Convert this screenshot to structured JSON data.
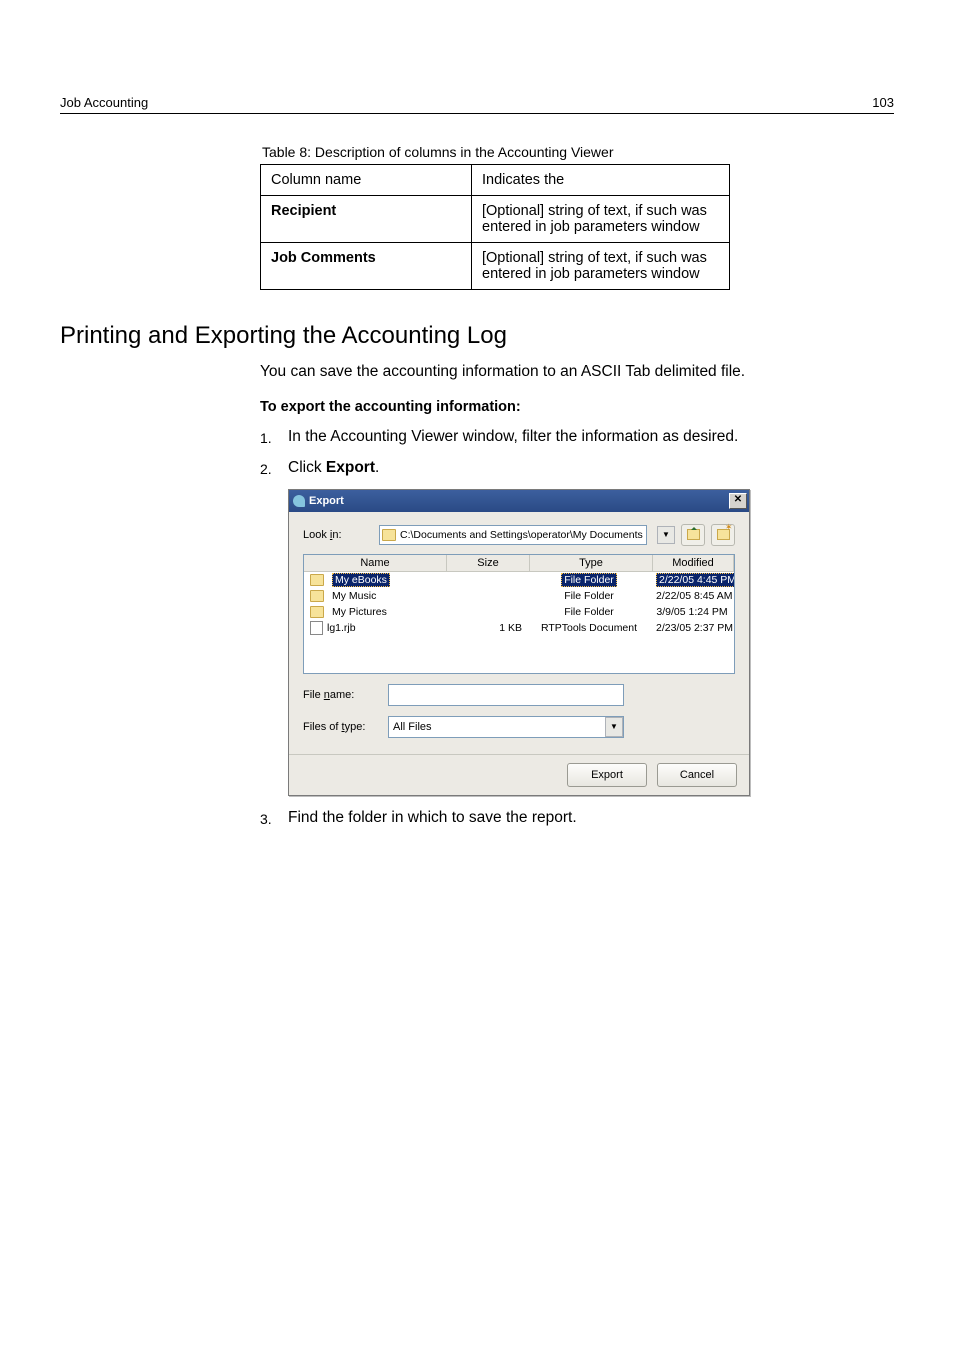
{
  "header": {
    "section": "Job Accounting",
    "page_number": "103"
  },
  "table": {
    "caption": "Table 8: Description of columns in the Accounting Viewer",
    "head": {
      "col1": "Column name",
      "col2": "Indicates the"
    },
    "rows": [
      {
        "name": "Recipient",
        "desc": "[Optional] string of text, if such was entered in job parameters window"
      },
      {
        "name": "Job Comments",
        "desc": "[Optional] string of text, if such was entered in job parameters window"
      }
    ]
  },
  "section_title": "Printing and Exporting the Accounting Log",
  "intro": "You can save the accounting information to an ASCII Tab delimited file.",
  "lead": "To export the accounting information:",
  "steps": {
    "s1": "In the Accounting Viewer window, filter the information as desired.",
    "s2_pre": "Click ",
    "s2_strong": "Export",
    "s2_post": ".",
    "s3": "Find the folder in which to save the report."
  },
  "nums": {
    "n1": "1.",
    "n2": "2.",
    "n3": "3."
  },
  "dialog": {
    "title": "Export",
    "lookin_label": "Look in:",
    "lookin_letter": "i",
    "path": "C:\\Documents and Settings\\operator\\My Documents",
    "columns": {
      "name": "Name",
      "size": "Size",
      "type": "Type",
      "modified": "Modified"
    },
    "rows": [
      {
        "name": "My eBooks",
        "size": "",
        "type": "File Folder",
        "modified": "2/22/05 4:45 PM",
        "icon": "folder",
        "selected": true
      },
      {
        "name": "My Music",
        "size": "",
        "type": "File Folder",
        "modified": "2/22/05 8:45 AM",
        "icon": "folder",
        "selected": false
      },
      {
        "name": "My Pictures",
        "size": "",
        "type": "File Folder",
        "modified": "3/9/05 1:24 PM",
        "icon": "folder",
        "selected": false
      },
      {
        "name": "lg1.rjb",
        "size": "1 KB",
        "type": "RTPTools Document",
        "modified": "2/23/05 2:37 PM",
        "icon": "file",
        "selected": false
      }
    ],
    "filename_label": "File name:",
    "filename_letter": "n",
    "filename_value": "",
    "filetype_label": "Files of type:",
    "filetype_letter": "t",
    "filetype_value": "All Files",
    "buttons": {
      "export": "Export",
      "cancel": "Cancel"
    }
  }
}
